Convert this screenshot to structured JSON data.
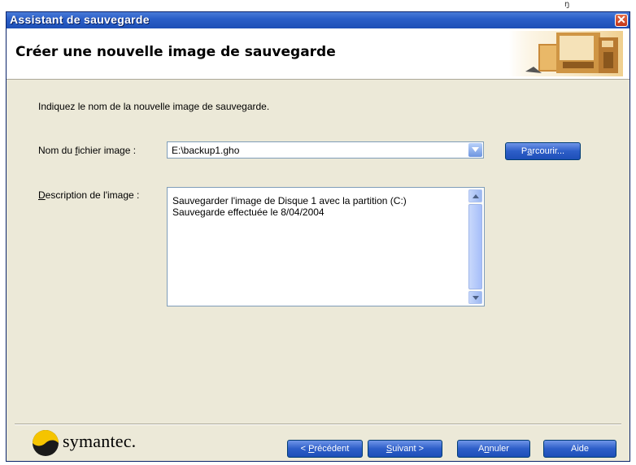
{
  "corner_mark": "ŋ",
  "window": {
    "title": "Assistant de sauvegarde",
    "close_glyph": "✕"
  },
  "header": {
    "title": "Créer une nouvelle image de sauvegarde"
  },
  "instruction": "Indiquez le nom de la nouvelle image de sauvegarde.",
  "filename": {
    "label_before": "Nom du ",
    "label_accel": "f",
    "label_after": "ichier image :",
    "value": "E:\\backup1.gho"
  },
  "browse": {
    "before": "P",
    "accel": "a",
    "after": "rcourir..."
  },
  "description": {
    "label_accel": "D",
    "label_after": "escription de l'image :",
    "value": "Sauvegarder l'image de Disque 1 avec la partition (C:)\nSauvegarde effectuée le 8/04/2004"
  },
  "footer": {
    "logo_text": "symantec.",
    "prev": {
      "prefix": "< ",
      "accel": "P",
      "after": "récédent"
    },
    "next": {
      "accel": "S",
      "after": "uivant >"
    },
    "cancel": {
      "before": "A",
      "accel": "n",
      "after": "nuler"
    },
    "help": "Aide"
  },
  "colors": {
    "titlebar": "#2b5fc8",
    "button": "#2d5ec8",
    "face": "#ece9d8",
    "logo_yellow": "#f5c400"
  }
}
